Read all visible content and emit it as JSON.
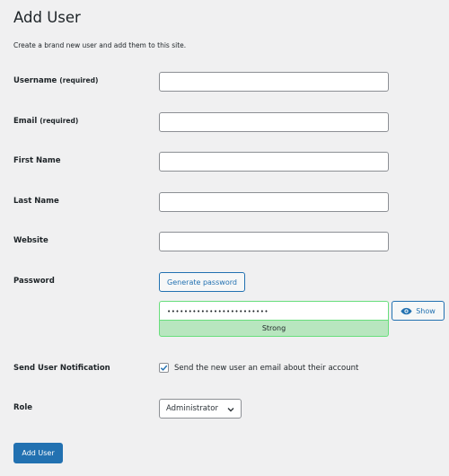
{
  "header": {
    "title": "Add User",
    "description": "Create a brand new user and add them to this site."
  },
  "fields": {
    "username": {
      "label": "Username",
      "required": "(required)",
      "value": ""
    },
    "email": {
      "label": "Email",
      "required": "(required)",
      "value": ""
    },
    "first_name": {
      "label": "First Name",
      "value": ""
    },
    "last_name": {
      "label": "Last Name",
      "value": ""
    },
    "website": {
      "label": "Website",
      "value": ""
    }
  },
  "password": {
    "label": "Password",
    "generate_label": "Generate password",
    "masked_value": "••••••••••••••••••••••••",
    "strength": "Strong",
    "show_label": "Show",
    "strength_color": "#b8e6bf"
  },
  "notification": {
    "label": "Send User Notification",
    "checkbox_text": "Send the new user an email about their account",
    "checked": true
  },
  "role": {
    "label": "Role",
    "selected": "Administrator"
  },
  "submit": {
    "label": "Add User"
  },
  "colors": {
    "primary": "#2271b1",
    "background": "#f0f0f1",
    "success_border": "#68de7c"
  }
}
